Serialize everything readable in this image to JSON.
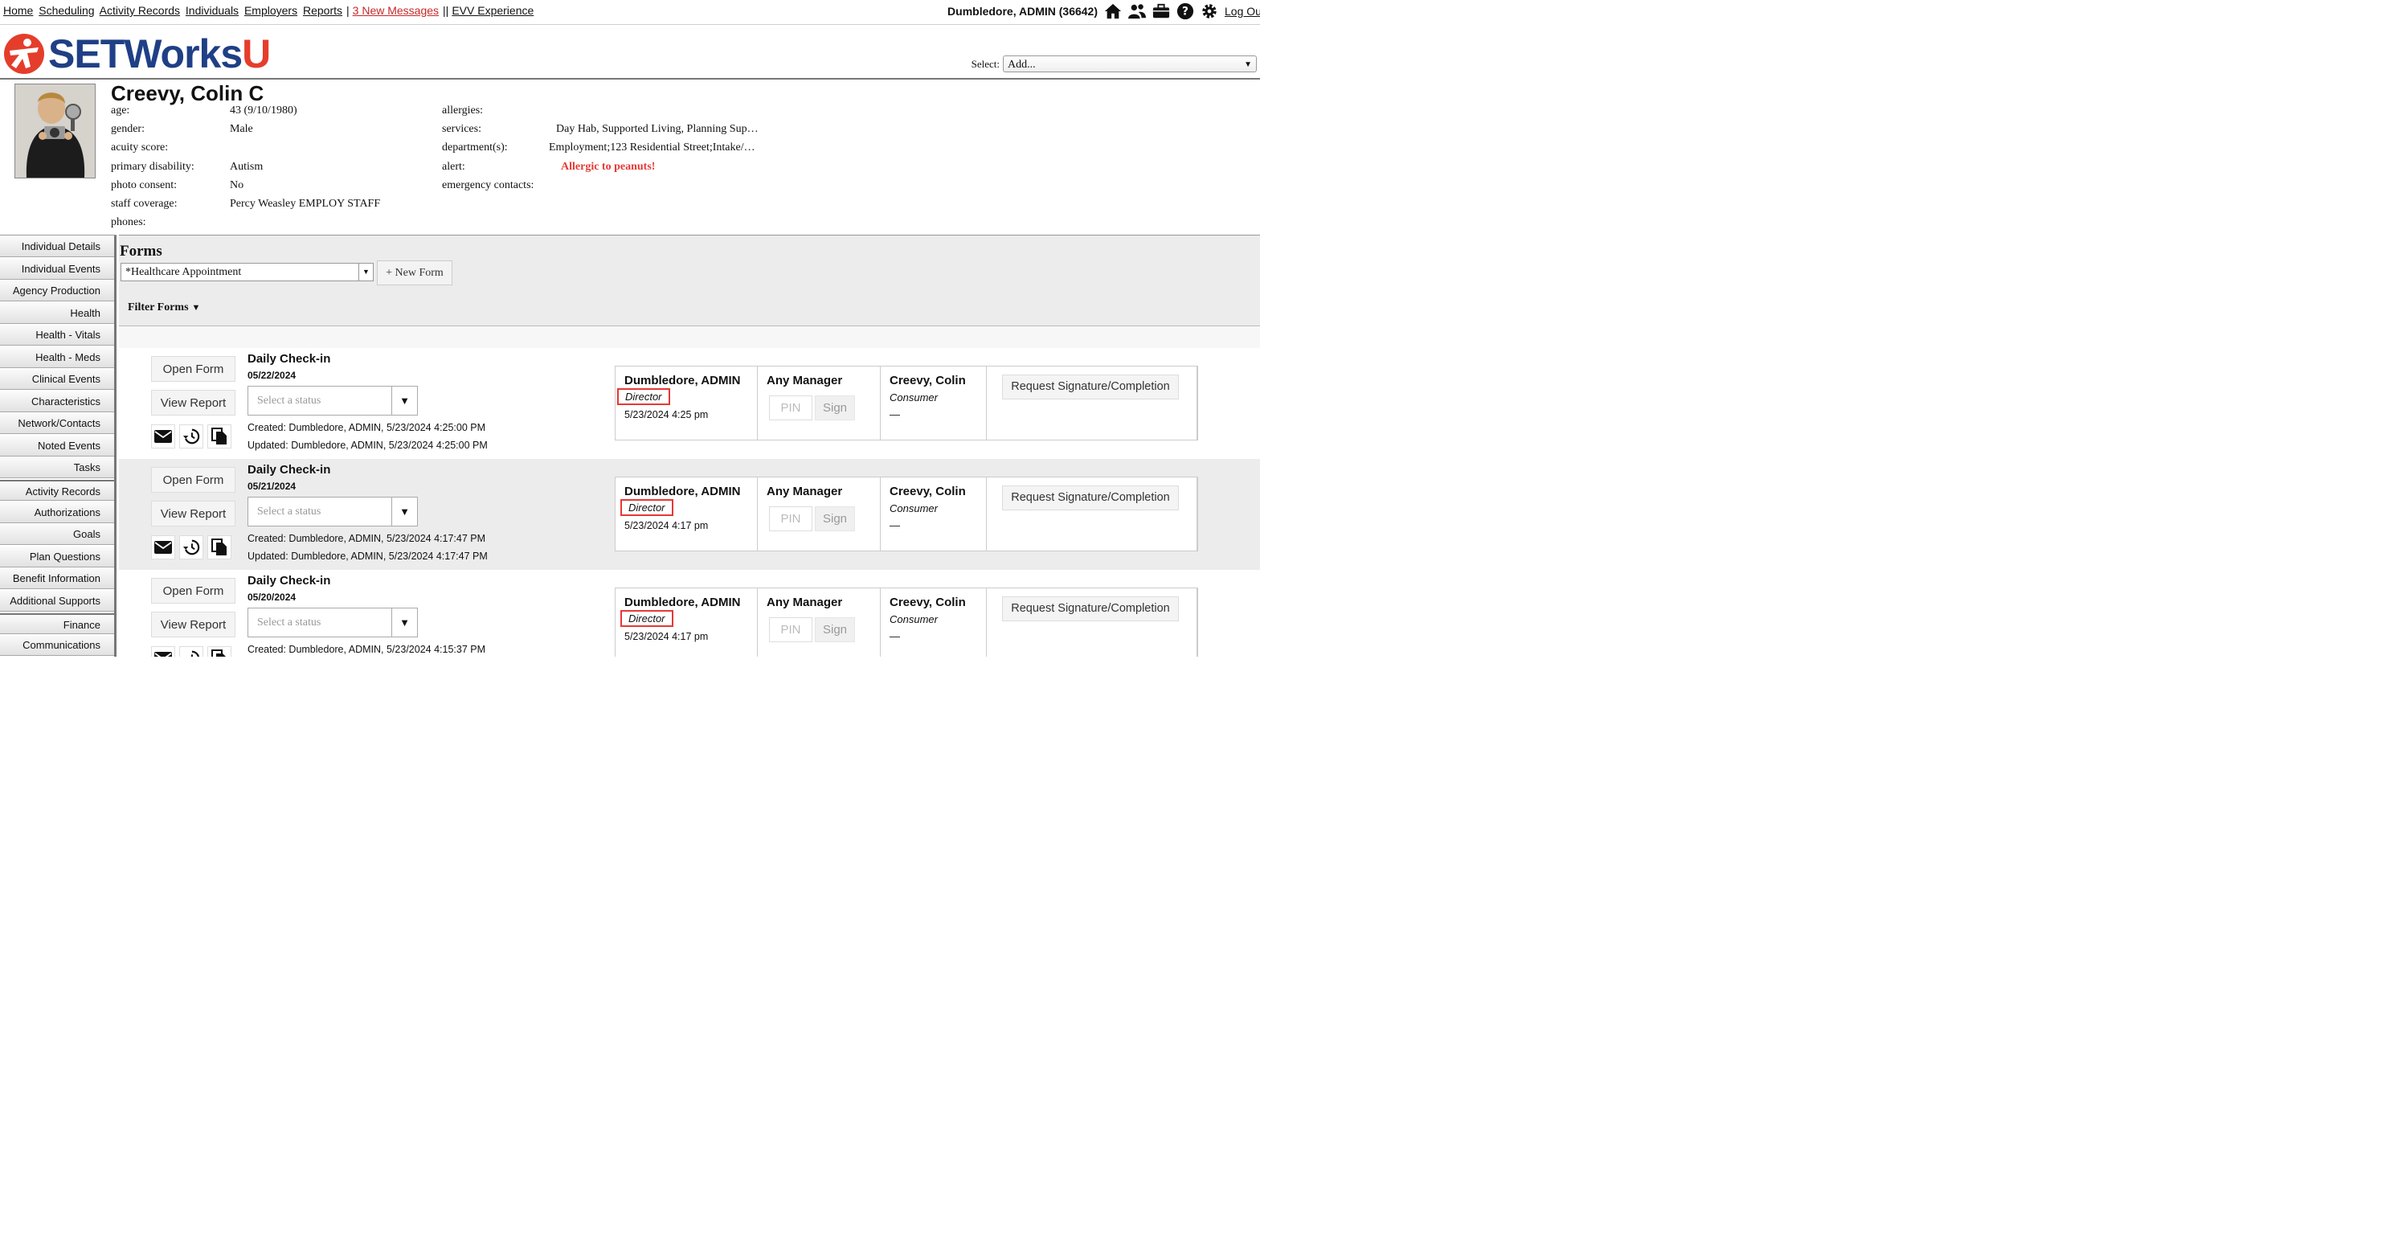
{
  "topnav": {
    "links": [
      "Home",
      "Scheduling",
      "Activity Records",
      "Individuals",
      "Employers",
      "Reports"
    ],
    "messages": "3 New Messages",
    "evv": "EVV Experience",
    "user": "Dumbledore, ADMIN  (36642)",
    "logout": "Log Out"
  },
  "brand": {
    "name": "SETWorks",
    "suffix": "U"
  },
  "select": {
    "label": "Select:",
    "value": "Add..."
  },
  "profile": {
    "name": "Creevy, Colin C",
    "left": [
      {
        "k": "age:",
        "v": "43 (9/10/1980)"
      },
      {
        "k": "gender:",
        "v": "Male"
      },
      {
        "k": "acuity score:",
        "v": ""
      },
      {
        "k": "primary disability:",
        "v": "Autism"
      },
      {
        "k": "photo consent:",
        "v": "No"
      },
      {
        "k": "staff coverage:",
        "v": "Percy Weasley EMPLOY STAFF"
      },
      {
        "k": "phones:",
        "v": ""
      }
    ],
    "right": [
      {
        "k": "allergies:",
        "v": ""
      },
      {
        "k": "services:",
        "v": "Day Hab, Supported Living, Planning Sup…"
      },
      {
        "k": "department(s):",
        "v": "Employment;123 Residential Street;Intake/…"
      },
      {
        "k": "alert:",
        "v": "Allergic to peanuts!"
      },
      {
        "k": "emergency contacts:",
        "v": ""
      }
    ]
  },
  "sidebar": [
    "Individual Details",
    "Individual Events",
    "Agency Production",
    "Health",
    "Health - Vitals",
    "Health - Meds",
    "Clinical Events",
    "Characteristics",
    "Network/Contacts",
    "Noted Events",
    "Tasks",
    "Activity Records",
    "Authorizations",
    "Goals",
    "Plan Questions",
    "Benefit Information",
    "Additional Supports",
    "Finance",
    "Communications"
  ],
  "forms": {
    "title": "Forms",
    "selected_form": "*Healthcare Appointment",
    "new_form": "+ New Form",
    "filter": "Filter Forms",
    "open_form": "Open Form",
    "view_report": "View Report",
    "status_placeholder": "Select a status",
    "pin_placeholder": "PIN",
    "sign": "Sign",
    "request": "Request Signature/Completion",
    "rows": [
      {
        "title": "Daily Check-in",
        "date": "05/22/2024",
        "created": "Created:  Dumbledore, ADMIN, 5/23/2024 4:25:00 PM",
        "updated": "Updated:  Dumbledore, ADMIN, 5/23/2024 4:25:00 PM",
        "signer": "Dumbledore, ADMIN",
        "signer_role": "Director",
        "signed_at": "5/23/2024 4:25 pm",
        "manager": "Any Manager",
        "consumer": "Creevy, Colin",
        "consumer_role": "Consumer",
        "consumer_sig": "—"
      },
      {
        "title": "Daily Check-in",
        "date": "05/21/2024",
        "created": "Created:  Dumbledore, ADMIN, 5/23/2024 4:17:47 PM",
        "updated": "Updated:  Dumbledore, ADMIN, 5/23/2024 4:17:47 PM",
        "signer": "Dumbledore, ADMIN",
        "signer_role": "Director",
        "signed_at": "5/23/2024 4:17 pm",
        "manager": "Any Manager",
        "consumer": "Creevy, Colin",
        "consumer_role": "Consumer",
        "consumer_sig": "—"
      },
      {
        "title": "Daily Check-in",
        "date": "05/20/2024",
        "created": "Created:  Dumbledore, ADMIN, 5/23/2024 4:15:37 PM",
        "updated": "",
        "signer": "Dumbledore, ADMIN",
        "signer_role": "Director",
        "signed_at": "5/23/2024 4:17 pm",
        "manager": "Any Manager",
        "consumer": "Creevy, Colin",
        "consumer_role": "Consumer",
        "consumer_sig": "—"
      }
    ]
  },
  "colors": {
    "brand_blue": "#1f3f86",
    "brand_red": "#e53d2c",
    "alert": "#e53935",
    "message_link": "#c62828"
  },
  "icons": [
    "home-icon",
    "users-icon",
    "briefcase-icon",
    "help-icon",
    "gear-icon",
    "email-icon",
    "history-icon",
    "copy-icon"
  ]
}
